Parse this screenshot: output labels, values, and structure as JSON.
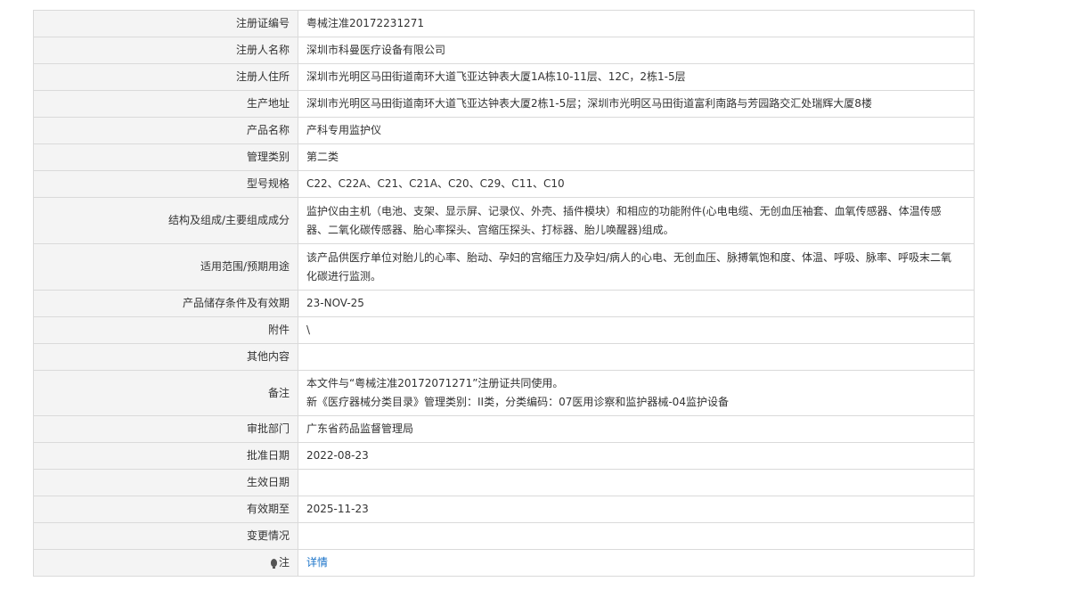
{
  "rows": [
    {
      "label": "注册证编号",
      "value": "粤械注准20172231271"
    },
    {
      "label": "注册人名称",
      "value": "深圳市科曼医疗设备有限公司"
    },
    {
      "label": "注册人住所",
      "value": "深圳市光明区马田街道南环大道飞亚达钟表大厦1A栋10-11层、12C，2栋1-5层"
    },
    {
      "label": "生产地址",
      "value": "深圳市光明区马田街道南环大道飞亚达钟表大厦2栋1-5层；深圳市光明区马田街道富利南路与芳园路交汇处瑞辉大厦8楼"
    },
    {
      "label": "产品名称",
      "value": "产科专用监护仪"
    },
    {
      "label": "管理类别",
      "value": "第二类"
    },
    {
      "label": "型号规格",
      "value": "C22、C22A、C21、C21A、C20、C29、C11、C10"
    },
    {
      "label": "结构及组成/主要组成成分",
      "value": "监护仪由主机（电池、支架、显示屏、记录仪、外壳、插件模块）和相应的功能附件(心电电缆、无创血压袖套、血氧传感器、体温传感器、二氧化碳传感器、胎心率探头、宫缩压探头、打标器、胎儿唤醒器)组成。"
    },
    {
      "label": "适用范围/预期用途",
      "value": "该产品供医疗单位对胎儿的心率、胎动、孕妇的宫缩压力及孕妇/病人的心电、无创血压、脉搏氧饱和度、体温、呼吸、脉率、呼吸末二氧化碳进行监测。"
    },
    {
      "label": "产品储存条件及有效期",
      "value": "23-NOV-25"
    },
    {
      "label": "附件",
      "value": "\\"
    },
    {
      "label": "其他内容",
      "value": ""
    },
    {
      "label": "备注",
      "value_lines": [
        "本文件与“粤械注准20172071271”注册证共同使用。",
        "新《医疗器械分类目录》管理类别：II类，分类编码：07医用诊察和监护器械-04监护设备"
      ]
    },
    {
      "label": "审批部门",
      "value": "广东省药品监督管理局"
    },
    {
      "label": "批准日期",
      "value": "2022-08-23"
    },
    {
      "label": "生效日期",
      "value": ""
    },
    {
      "label": "有效期至",
      "value": "2025-11-23"
    },
    {
      "label": "变更情况",
      "value": ""
    },
    {
      "label": "注",
      "value": "详情",
      "icon": "lightbulb-icon"
    }
  ],
  "colors": {
    "label_bg": "#f4f4f4",
    "border": "#dadada",
    "link": "#1a73c9",
    "text": "#333333"
  }
}
